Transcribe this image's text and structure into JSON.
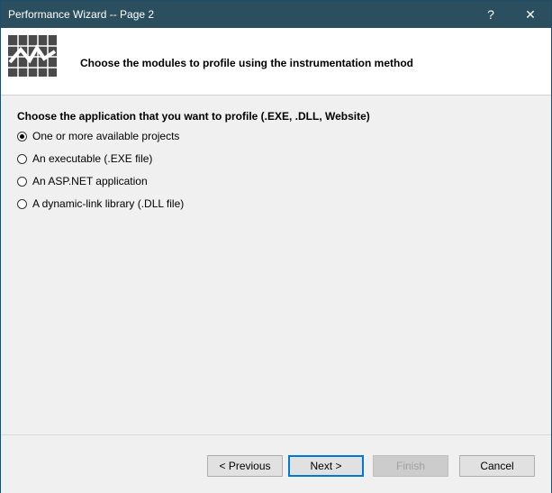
{
  "window": {
    "title": "Performance Wizard -- Page 2",
    "help_glyph": "?",
    "close_glyph": "✕"
  },
  "banner": {
    "icon": "performance-chart-icon",
    "heading": "Choose the modules to profile using the instrumentation method"
  },
  "main": {
    "group_label": "Choose the application that you want to profile (.EXE, .DLL, Website)",
    "options": [
      {
        "label": "One or more available projects",
        "selected": true
      },
      {
        "label": "An executable (.EXE file)",
        "selected": false
      },
      {
        "label": "An ASP.NET application",
        "selected": false
      },
      {
        "label": "A dynamic-link library (.DLL file)",
        "selected": false
      }
    ]
  },
  "footer": {
    "previous_label": "< Previous",
    "next_label": "Next >",
    "finish_label": "Finish",
    "cancel_label": "Cancel"
  },
  "colors": {
    "titlebar": "#2b4f5e",
    "default_button_border": "#0078d7"
  }
}
